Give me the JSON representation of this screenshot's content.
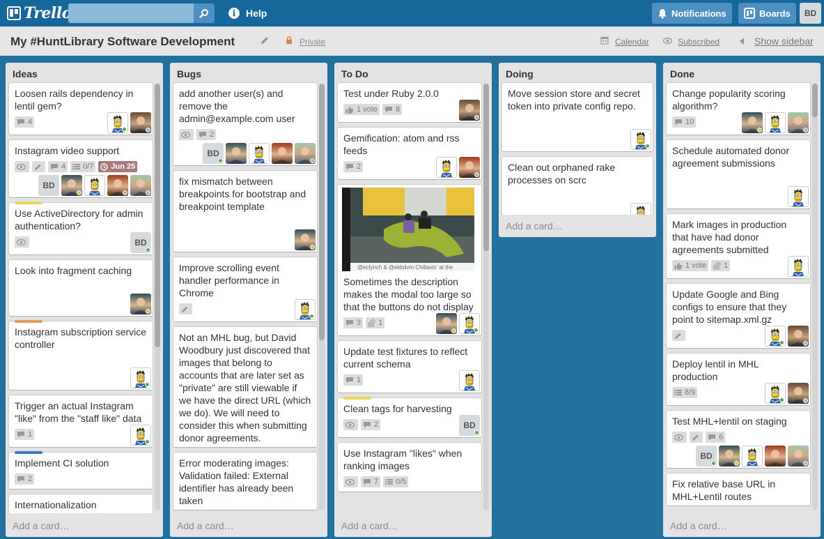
{
  "header": {
    "logo_text": "Trello",
    "search_placeholder": "",
    "help_label": "Help",
    "notifications_label": "Notifications",
    "boards_label": "Boards",
    "user_initials": "BD"
  },
  "board": {
    "title": "My #HuntLibrary Software Development",
    "visibility": "Private",
    "calendar_label": "Calendar",
    "subscribed_label": "Subscribed",
    "show_sidebar_label": "Show sidebar"
  },
  "add_card_label": "Add a card…",
  "lists": [
    {
      "title": "Ideas",
      "cards": [
        {
          "title": "Loosen rails dependency in lentil gem?",
          "badges": [
            {
              "icon": "comment-icon",
              "text": "4"
            }
          ],
          "members": [
            "simpson:green",
            "man1:gray"
          ]
        },
        {
          "title": "Instagram video support",
          "badges": [
            {
              "icon": "eye-icon",
              "text": ""
            },
            {
              "icon": "pencil-icon",
              "text": ""
            },
            {
              "icon": "comment-icon",
              "text": "4"
            },
            {
              "icon": "checklist-icon",
              "text": "0/7"
            },
            {
              "icon": "clock-icon",
              "text": "Jun 25",
              "due": true
            }
          ],
          "members": [
            "bd:",
            "man2:yellow",
            "simpson:",
            "man4:gray",
            "man3:gray"
          ]
        },
        {
          "label": "#e8d95a",
          "title": "Use ActiveDirectory for admin authentication?",
          "badges": [
            {
              "icon": "eye-icon",
              "text": ""
            }
          ],
          "members": [
            "bd:green"
          ]
        },
        {
          "title": "Look into fragment caching",
          "badges": [],
          "members": [
            "man2:yellow"
          ]
        },
        {
          "label": "#e09c5a",
          "title": "Instagram subscription service controller",
          "badges": [],
          "members": [
            "simpson:green"
          ]
        },
        {
          "title": "Trigger an actual Instagram \"like\" from the \"staff like\" data",
          "badges": [
            {
              "icon": "comment-icon",
              "text": "1"
            }
          ],
          "members": [
            "simpson:green"
          ]
        },
        {
          "label": "#3e79c9",
          "title": "Implement CI solution",
          "badges": [
            {
              "icon": "comment-icon",
              "text": "2"
            }
          ],
          "members": []
        },
        {
          "title": "Internationalization",
          "badges": [],
          "members": []
        }
      ]
    },
    {
      "title": "Bugs",
      "cards": [
        {
          "title": "add another user(s) and remove the admin@example.com user",
          "badges": [
            {
              "icon": "eye-icon",
              "text": ""
            },
            {
              "icon": "comment-icon",
              "text": "2"
            }
          ],
          "members": [
            "bd:green",
            "man2:",
            "simpson:",
            "man4:",
            "man3:gray"
          ]
        },
        {
          "title": "fix mismatch between breakpoints for bootstrap and breakpoint template",
          "badges": [],
          "members": [
            "man2:yellow"
          ]
        },
        {
          "title": "Improve scrolling event handler performance in Chrome",
          "badges": [
            {
              "icon": "pencil-icon",
              "text": ""
            }
          ],
          "members": [
            "simpson:green"
          ]
        },
        {
          "title": "Not an MHL bug, but David Woodbury just discovered that images that belong to accounts that are later set as \"private\" are still viewable if we have the direct URL (which we do). We will need to consider this when submitting donor agreements.",
          "badges": [],
          "members": []
        },
        {
          "title": "Error moderating images: Validation failed: External identifier has already been taken",
          "badges": [],
          "members": []
        }
      ]
    },
    {
      "title": "To Do",
      "cards": [
        {
          "title": "Test under Ruby 2.0.0",
          "badges": [
            {
              "icon": "thumb-icon",
              "text": "1 vote"
            },
            {
              "icon": "comment-icon",
              "text": "8"
            }
          ],
          "members": [
            "man1:gray"
          ]
        },
        {
          "title": "Gemification: atom and rss feeds",
          "badges": [
            {
              "icon": "comment-icon",
              "text": "2"
            }
          ],
          "members": [
            "simpson:",
            "man4:gray"
          ]
        },
        {
          "photo": true,
          "photo_caption": "@eclynch & @ekbdvm Chillaxin' at the",
          "title": "Sometimes the description makes the modal too large so that the buttons do not display",
          "badges": [
            {
              "icon": "comment-icon",
              "text": "3"
            },
            {
              "icon": "paperclip-icon",
              "text": "1"
            }
          ],
          "members": [
            "man2:yellow",
            "simpson:green"
          ]
        },
        {
          "title": "Update test fixtures to reflect current schema",
          "badges": [
            {
              "icon": "comment-icon",
              "text": "1"
            }
          ],
          "members": [
            "simpson:"
          ]
        },
        {
          "label": "#e8d95a",
          "title": "Clean tags for harvesting",
          "badges": [
            {
              "icon": "eye-icon",
              "text": ""
            },
            {
              "icon": "comment-icon",
              "text": "2"
            }
          ],
          "members": [
            "bd:green"
          ]
        },
        {
          "title": "Use Instagram \"likes\" when ranking images",
          "badges": [
            {
              "icon": "eye-icon",
              "text": ""
            },
            {
              "icon": "comment-icon",
              "text": "7"
            },
            {
              "icon": "checklist-icon",
              "text": "0/5"
            }
          ],
          "members": []
        }
      ]
    },
    {
      "title": "Doing",
      "cards": [
        {
          "title": "Move session store and secret token into private config repo.",
          "badges": [],
          "members": [
            "simpson:green"
          ]
        },
        {
          "title": "Clean out orphaned rake processes on scrc",
          "badges": [],
          "members": [
            "simpson:green"
          ]
        }
      ]
    },
    {
      "title": "Done",
      "cards": [
        {
          "title": "Change popularity scoring algorithm?",
          "badges": [
            {
              "icon": "comment-icon",
              "text": "10"
            }
          ],
          "members": [
            "man2:yellow",
            "simpson:",
            "man3:gray"
          ]
        },
        {
          "title": "Schedule automated donor agreement submissions",
          "badges": [],
          "members": [
            "simpson:"
          ]
        },
        {
          "title": "Mark images in production that have had donor agreements submitted",
          "badges": [
            {
              "icon": "thumb-icon",
              "text": "1 vote"
            },
            {
              "icon": "paperclip-icon",
              "text": "1"
            }
          ],
          "members": [
            "simpson:"
          ]
        },
        {
          "title": "Update Google and Bing configs to ensure that they point to sitemap.xml.gz",
          "badges": [
            {
              "icon": "pencil-icon",
              "text": ""
            }
          ],
          "members": [
            "simpson:green",
            "man1:gray"
          ]
        },
        {
          "title": "Deploy lentil in MHL production",
          "badges": [
            {
              "icon": "checklist-icon",
              "text": "8/9"
            }
          ],
          "members": [
            "simpson:green",
            "man1:gray"
          ]
        },
        {
          "title": "Test MHL+lentil on staging",
          "badges": [
            {
              "icon": "eye-icon",
              "text": ""
            },
            {
              "icon": "pencil-icon",
              "text": ""
            },
            {
              "icon": "comment-icon",
              "text": "6"
            }
          ],
          "members": [
            "bd:green",
            "man2:yellow",
            "simpson:",
            "man4:",
            "man3:gray"
          ]
        },
        {
          "title": "Fix relative base URL in MHL+Lentil routes",
          "badges": [],
          "members": []
        }
      ]
    }
  ],
  "colors": {
    "online": "#5aac44",
    "away": "#d9c53a",
    "offline": "#b0b0b0"
  }
}
